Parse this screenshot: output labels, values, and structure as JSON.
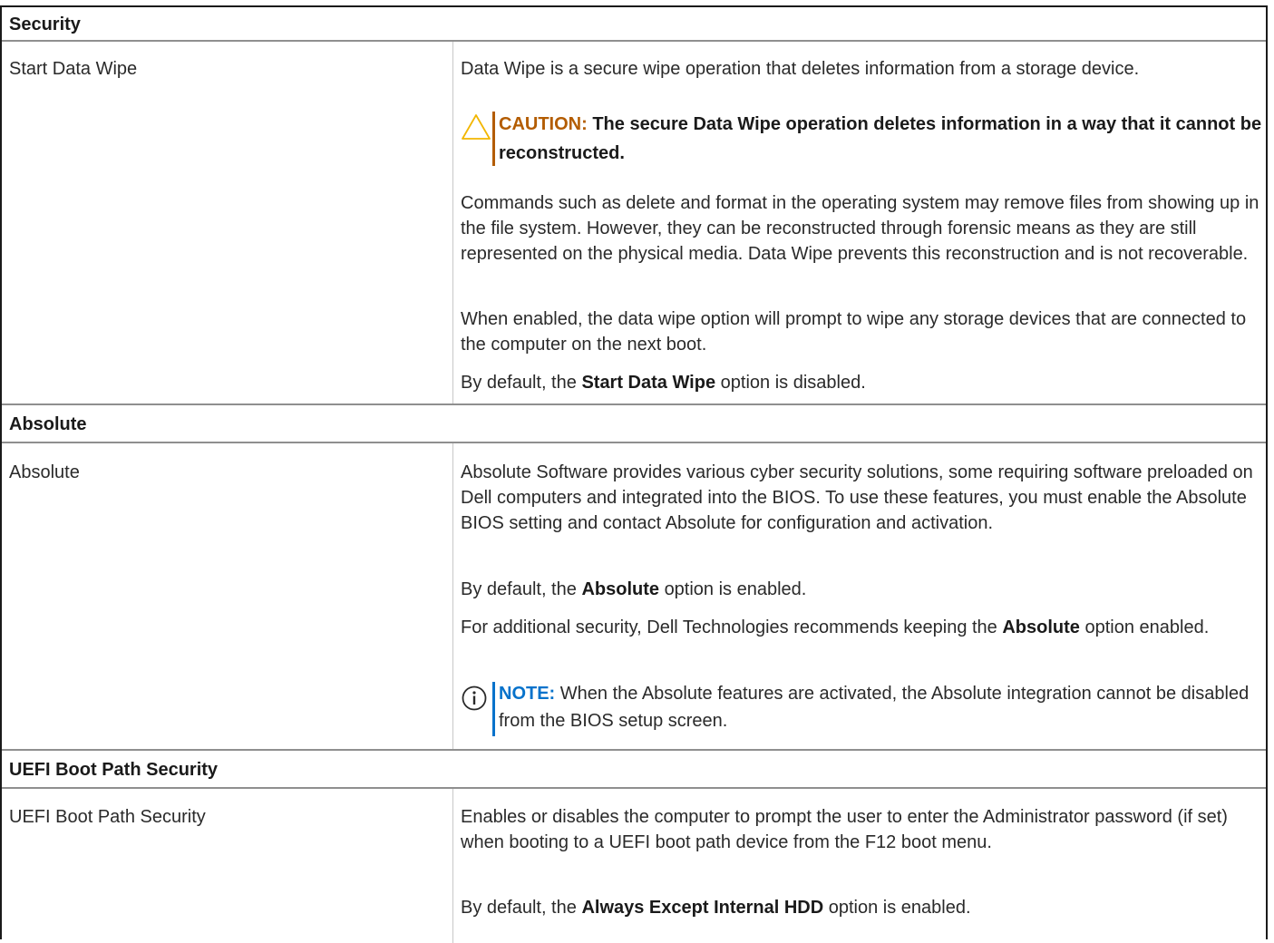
{
  "sections": {
    "security": {
      "title": "Security",
      "row": {
        "label": "Start Data Wipe",
        "desc1": "Data Wipe is a secure wipe operation that deletes information from a storage device.",
        "caution": {
          "label": "CAUTION:",
          "text": "The secure Data Wipe operation deletes information in a way that it cannot be reconstructed."
        },
        "desc2": "Commands such as delete and format in the operating system may remove files from showing up in the file system. However, they can be reconstructed through forensic means as they are still represented on the physical media. Data Wipe prevents this reconstruction and is not recoverable.",
        "desc3": "When enabled, the data wipe option will prompt to wipe any storage devices that are connected to the computer on the next boot.",
        "default": {
          "prefix": "By default, the",
          "option": "Start Data Wipe",
          "suffix": "option is disabled."
        }
      }
    },
    "absolute": {
      "title": "Absolute",
      "row": {
        "label": "Absolute",
        "desc1": "Absolute Software provides various cyber security solutions, some requiring software preloaded on Dell computers and integrated into the BIOS. To use these features, you must enable the Absolute BIOS setting and contact Absolute for configuration and activation.",
        "default": {
          "prefix": "By default, the",
          "option": "Absolute",
          "suffix": "option is enabled."
        },
        "recommend": {
          "prefix": "For additional security, Dell Technologies recommends keeping the",
          "option": "Absolute",
          "suffix": "option enabled."
        },
        "note": {
          "label": "NOTE:",
          "text": "When the Absolute features are activated, the Absolute integration cannot be disabled from the BIOS setup screen."
        }
      }
    },
    "uefi": {
      "title": "UEFI Boot Path Security",
      "row": {
        "label": "UEFI Boot Path Security",
        "desc1": "Enables or disables the computer to prompt the user to enter the Administrator password (if set) when booting to a UEFI boot path device from the F12 boot menu.",
        "default": {
          "prefix": "By default, the",
          "option": "Always Except Internal HDD",
          "suffix": "option is enabled."
        }
      }
    }
  },
  "colors": {
    "caution": "#b35c00",
    "caution_icon": "#f2b600",
    "note": "#0672cb"
  },
  "icons": {
    "caution": "warning-triangle-icon",
    "note": "info-circle-icon"
  }
}
